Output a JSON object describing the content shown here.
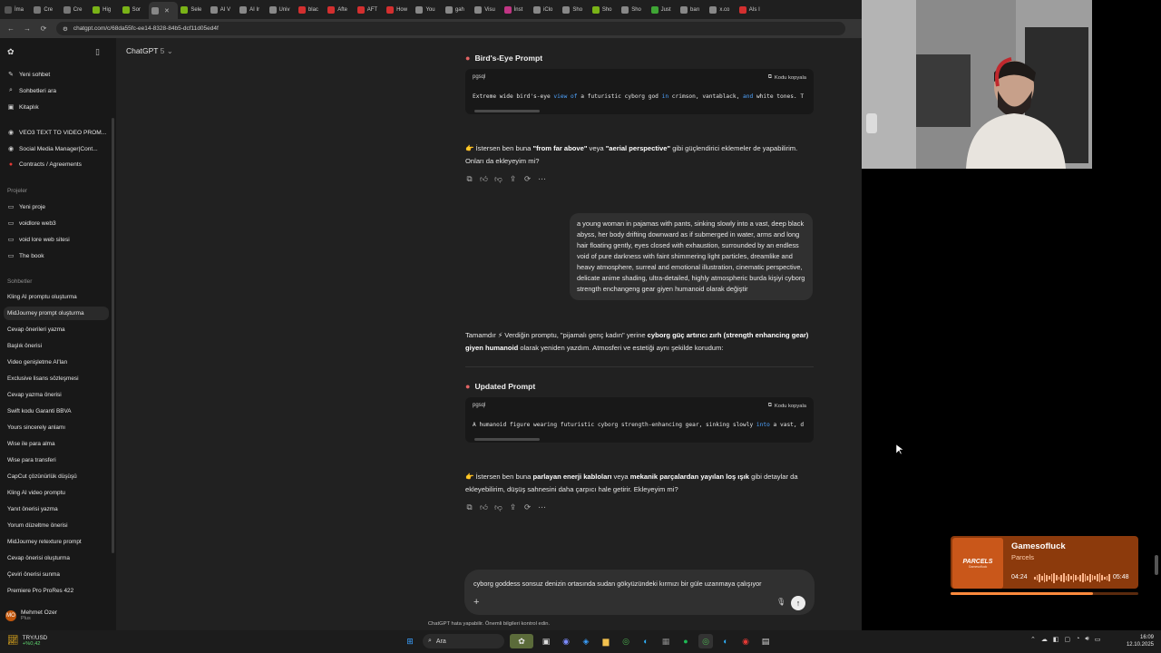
{
  "browser": {
    "tabs": [
      {
        "label": "İma",
        "color": "#555"
      },
      {
        "label": "Cre",
        "color": "#777"
      },
      {
        "label": "Cre",
        "color": "#777"
      },
      {
        "label": "Hig",
        "color": "#7ab317"
      },
      {
        "label": "Sor",
        "color": "#7ab317"
      },
      {
        "label": "",
        "color": "#888",
        "active": true
      },
      {
        "label": "Sele",
        "color": "#7ab317"
      },
      {
        "label": "AI V",
        "color": "#888"
      },
      {
        "label": "AI Ir",
        "color": "#888"
      },
      {
        "label": "Univ",
        "color": "#888"
      },
      {
        "label": "blac",
        "color": "#d32f2f"
      },
      {
        "label": "Afte",
        "color": "#d32f2f"
      },
      {
        "label": "AFT",
        "color": "#d32f2f"
      },
      {
        "label": "How",
        "color": "#d32f2f"
      },
      {
        "label": "You",
        "color": "#888"
      },
      {
        "label": "gah",
        "color": "#888"
      },
      {
        "label": "Visu",
        "color": "#888"
      },
      {
        "label": "İnst",
        "color": "#c13584"
      },
      {
        "label": "iClo",
        "color": "#888"
      },
      {
        "label": "Sho",
        "color": "#888"
      },
      {
        "label": "Sho",
        "color": "#7ab317"
      },
      {
        "label": "Sho",
        "color": "#888"
      },
      {
        "label": "Just",
        "color": "#3fa535"
      },
      {
        "label": "barı",
        "color": "#888"
      },
      {
        "label": "x.co",
        "color": "#888"
      },
      {
        "label": "AIs I",
        "color": "#d32f2f"
      }
    ],
    "url": "chatgpt.com/c/68da55fc-ee14-8328-84b5-dcf11d05ed4f"
  },
  "sidebar": {
    "top_items": [
      {
        "label": "Yeni sohbet",
        "icon": "edit-icon"
      },
      {
        "label": "Sohbetleri ara",
        "icon": "search-icon"
      },
      {
        "label": "Kitaplık",
        "icon": "library-icon"
      }
    ],
    "gpts": [
      {
        "label": "VEO3 TEXT TO VIDEO PROM...",
        "icon": "gpt-icon"
      },
      {
        "label": "Social Media Manager|Cont...",
        "icon": "gpt-icon"
      },
      {
        "label": "Contracts / Agreements",
        "icon": "gpt-icon"
      }
    ],
    "projects_header": "Projeler",
    "projects": [
      {
        "label": "Yeni proje",
        "icon": "new-folder-icon"
      },
      {
        "label": "voidlore web3",
        "icon": "folder-icon"
      },
      {
        "label": "void lore web sitesi",
        "icon": "folder-icon"
      },
      {
        "label": "The book",
        "icon": "folder-icon"
      }
    ],
    "chats_header": "Sohbetler",
    "chats": [
      "Kling AI promptu oluşturma",
      "MidJourney prompt oluşturma",
      "Cevap önerileri yazma",
      "Başlık önerisi",
      "Video genişletme AI'lan",
      "Exclusive lisans sözleşmesi",
      "Cevap yazma önerisi",
      "Swift kodu Garanti BBVA",
      "Yours sincerely anlamı",
      "Wise ile para alma",
      "Wise para transferi",
      "CapCut çözünürlük düşüşü",
      "Kling AI video promptu",
      "Yanıt önerisi yazma",
      "Yorum düzeltme önerisi",
      "MidJourney retexture prompt",
      "Cevap önerisi oluşturma",
      "Çeviri önerisi sunma",
      "Premiere Pro ProRes 422"
    ],
    "selected_chat": 1,
    "user": {
      "name": "Mehmet Ozer",
      "plan": "Plus",
      "initials": "MO"
    }
  },
  "header": {
    "model": "ChatGPT",
    "version": "5"
  },
  "conversation": {
    "section1_title": "Bird's-Eye Prompt",
    "code1": {
      "lang": "pgsql",
      "copy": "Kodu kopyala",
      "tokens": [
        {
          "t": "Extreme wide bird's-eye "
        },
        {
          "t": "view of",
          "kw": true
        },
        {
          "t": " a futuristic cyborg god "
        },
        {
          "t": "in",
          "kw": true
        },
        {
          "t": " crimson, vantablack, "
        },
        {
          "t": "and",
          "kw": true
        },
        {
          "t": " white tones. T"
        }
      ]
    },
    "reply1": [
      {
        "t": "👉 İstersen ben buna "
      },
      {
        "t": "\"from far above\"",
        "b": true
      },
      {
        "t": " veya "
      },
      {
        "t": "\"aerial perspective\"",
        "b": true
      },
      {
        "t": " gibi güçlendirici eklemeler de yapabilirim. Onları da ekleyeyim mi?"
      }
    ],
    "user_message": "a young woman in pajamas with pants, sinking slowly into a vast, deep black abyss, her body drifting downward as if submerged in water, arms and long hair floating gently, eyes closed with exhaustion, surrounded by an endless void of pure darkness with faint shimmering light particles, dreamlike and heavy atmosphere, surreal and emotional illustration, cinematic perspective, delicate anime shading, ultra-detailed, highly atmospheric burda kişiyi cyborg strength enchangeng gear giyen humanoid olarak değiştir",
    "reply2": [
      {
        "t": "Tamamdır ⚡ Verdiğin promptu, \"pijamalı genç kadın\" yerine "
      },
      {
        "t": "cyborg güç artırıcı zırh (strength enhancing gear) giyen humanoid",
        "b": true
      },
      {
        "t": " olarak yeniden yazdım. Atmosferi ve estetiği aynı şekilde korudum:"
      }
    ],
    "section2_title": "Updated Prompt",
    "code2": {
      "lang": "pgsql",
      "copy": "Kodu kopyala",
      "tokens": [
        {
          "t": "A humanoid figure wearing futuristic cyborg strength-enhancing gear, sinking slowly "
        },
        {
          "t": "into",
          "kw": true
        },
        {
          "t": " a vast, d"
        }
      ]
    },
    "reply3": [
      {
        "t": "👉 İstersen ben buna "
      },
      {
        "t": "parlayan enerji kabloları",
        "b": true
      },
      {
        "t": " veya "
      },
      {
        "t": "mekanik parçalardan yayılan loş ışık",
        "b": true
      },
      {
        "t": " gibi detaylar da ekleyebilirim, düşüş sahnesini daha çarpıcı hale getirir. Ekleyeyim mi?"
      }
    ]
  },
  "composer": {
    "text": "cyborg goddess sonsuz denizin ortasında sudan gökyüzündeki kırmızı bir güle uzanmaya çalışıyor",
    "disclaimer": "ChatGPT hata yapabilir. Önemli bilgileri kontrol edin."
  },
  "music_widget": {
    "artist": "Gamesofluck",
    "track": "Parcels",
    "album_title": "PARCELS",
    "album_sub": "Gamesofluck",
    "elapsed": "04:24",
    "total": "05:48",
    "progress": 0.76
  },
  "taskbar": {
    "weather_title": "TRY/USD",
    "weather_value": "+%0,42",
    "search_label": "Ara",
    "time": "16:09",
    "date": "12.10.2025"
  },
  "colors": {
    "accent_red": "#e36464",
    "link_blue": "#4ea3ff",
    "music_bg": "#8c3a0c"
  }
}
